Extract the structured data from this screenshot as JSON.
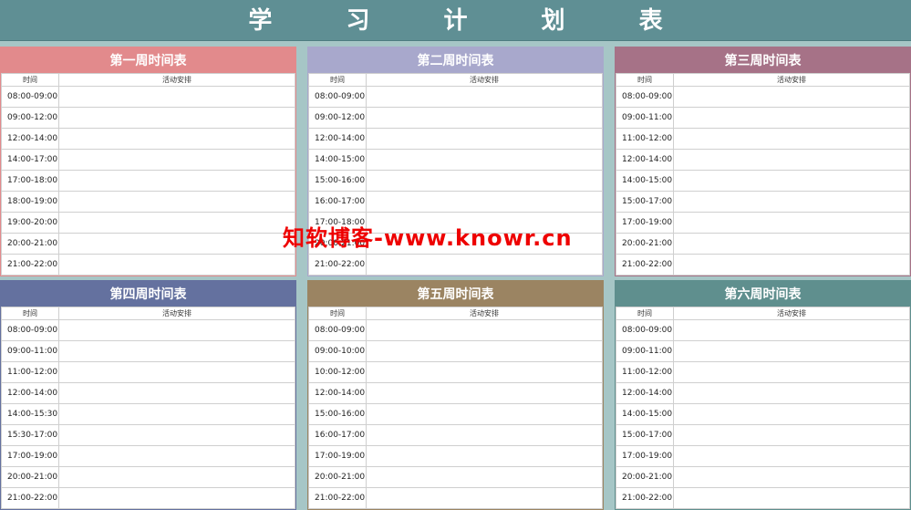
{
  "title": "学 习 计 划 表",
  "header_time": "时间",
  "header_activity": "活动安排",
  "watermark": "知软博客-www.knowr.cn",
  "panels": [
    {
      "title": "第一周时间表",
      "color": "#e28a8c",
      "slots": [
        "08:00-09:00",
        "09:00-12:00",
        "12:00-14:00",
        "14:00-17:00",
        "17:00-18:00",
        "18:00-19:00",
        "19:00-20:00",
        "20:00-21:00",
        "21:00-22:00"
      ]
    },
    {
      "title": "第二周时间表",
      "color": "#a8a8cc",
      "slots": [
        "08:00-09:00",
        "09:00-12:00",
        "12:00-14:00",
        "14:00-15:00",
        "15:00-16:00",
        "16:00-17:00",
        "17:00-18:00",
        "20:00-21:00",
        "21:00-22:00"
      ]
    },
    {
      "title": "第三周时间表",
      "color": "#a67287",
      "slots": [
        "08:00-09:00",
        "09:00-11:00",
        "11:00-12:00",
        "12:00-14:00",
        "14:00-15:00",
        "15:00-17:00",
        "17:00-19:00",
        "20:00-21:00",
        "21:00-22:00"
      ]
    },
    {
      "title": "第四周时间表",
      "color": "#64719f",
      "slots": [
        "08:00-09:00",
        "09:00-11:00",
        "11:00-12:00",
        "12:00-14:00",
        "14:00-15:30",
        "15:30-17:00",
        "17:00-19:00",
        "20:00-21:00",
        "21:00-22:00"
      ]
    },
    {
      "title": "第五周时间表",
      "color": "#9b8462",
      "slots": [
        "08:00-09:00",
        "09:00-10:00",
        "10:00-12:00",
        "12:00-14:00",
        "15:00-16:00",
        "16:00-17:00",
        "17:00-19:00",
        "20:00-21:00",
        "21:00-22:00"
      ]
    },
    {
      "title": "第六周时间表",
      "color": "#5f8f8e",
      "slots": [
        "08:00-09:00",
        "09:00-11:00",
        "11:00-12:00",
        "12:00-14:00",
        "14:00-15:00",
        "15:00-17:00",
        "17:00-19:00",
        "20:00-21:00",
        "21:00-22:00"
      ]
    }
  ]
}
